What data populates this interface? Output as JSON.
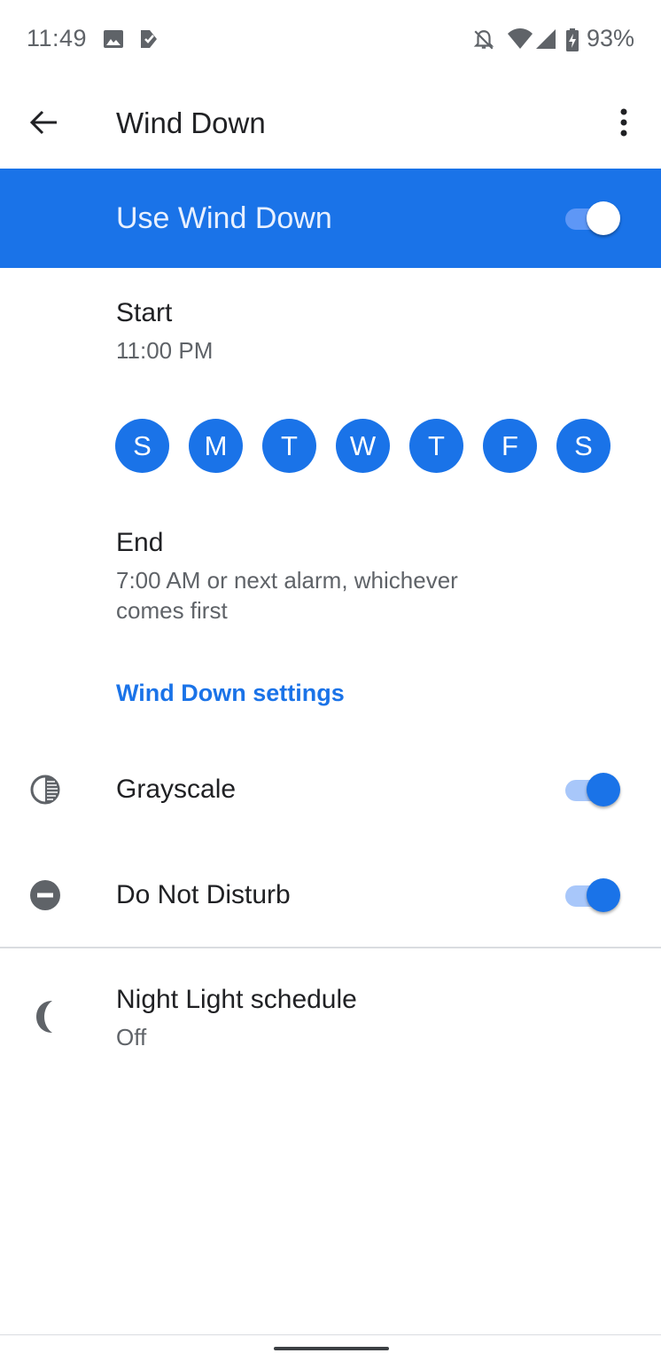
{
  "status_bar": {
    "time": "11:49",
    "left_icons": [
      "image-notification-icon",
      "tasks-notification-icon"
    ],
    "right_icons": [
      "alarm-off-icon",
      "wifi-icon",
      "cellular-signal-icon",
      "battery-charging-icon"
    ],
    "battery_percent": "93%"
  },
  "app_bar": {
    "title": "Wind Down",
    "back_icon": "arrow-back-icon",
    "more_icon": "more-vert-icon"
  },
  "master_switch": {
    "label": "Use Wind Down",
    "enabled": true
  },
  "schedule": {
    "start": {
      "title": "Start",
      "value": "11:00 PM"
    },
    "days": [
      {
        "label": "S",
        "selected": true
      },
      {
        "label": "M",
        "selected": true
      },
      {
        "label": "T",
        "selected": true
      },
      {
        "label": "W",
        "selected": true
      },
      {
        "label": "T",
        "selected": true
      },
      {
        "label": "F",
        "selected": true
      },
      {
        "label": "S",
        "selected": true
      }
    ],
    "end": {
      "title": "End",
      "value": "7:00 AM or next alarm, whichever comes first"
    }
  },
  "settings": {
    "header": "Wind Down settings",
    "items": [
      {
        "title": "Grayscale",
        "icon": "grayscale-icon",
        "enabled": true
      },
      {
        "title": "Do Not Disturb",
        "icon": "do-not-disturb-icon",
        "enabled": true
      }
    ]
  },
  "night_light": {
    "title": "Night Light schedule",
    "summary": "Off",
    "icon": "moon-icon"
  },
  "colors": {
    "accent": "#1a73e8",
    "text_primary": "#202124",
    "text_secondary": "#5f6368"
  }
}
